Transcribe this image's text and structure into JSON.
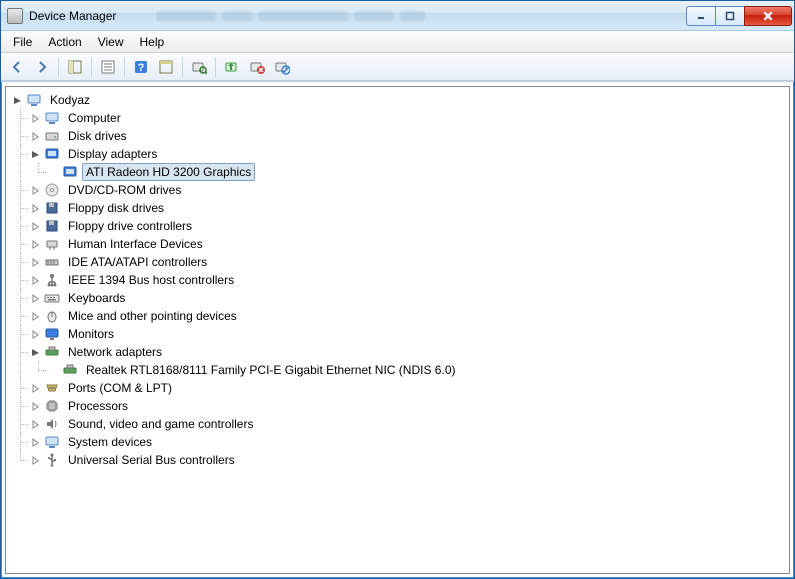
{
  "window": {
    "title": "Device Manager"
  },
  "menu": {
    "file": "File",
    "action": "Action",
    "view": "View",
    "help": "Help"
  },
  "tree": {
    "root": "Kodyaz",
    "computer": "Computer",
    "disk_drives": "Disk drives",
    "display_adapters": "Display adapters",
    "display_child": "ATI Radeon HD 3200 Graphics",
    "dvd": "DVD/CD-ROM drives",
    "floppy_disk": "Floppy disk drives",
    "floppy_ctrl": "Floppy drive controllers",
    "hid": "Human Interface Devices",
    "ide": "IDE ATA/ATAPI controllers",
    "ieee": "IEEE 1394 Bus host controllers",
    "keyboards": "Keyboards",
    "mice": "Mice and other pointing devices",
    "monitors": "Monitors",
    "network": "Network adapters",
    "network_child": "Realtek RTL8168/8111 Family PCI-E Gigabit Ethernet NIC (NDIS 6.0)",
    "ports": "Ports (COM & LPT)",
    "processors": "Processors",
    "sound": "Sound, video and game controllers",
    "system": "System devices",
    "usb": "Universal Serial Bus controllers"
  }
}
